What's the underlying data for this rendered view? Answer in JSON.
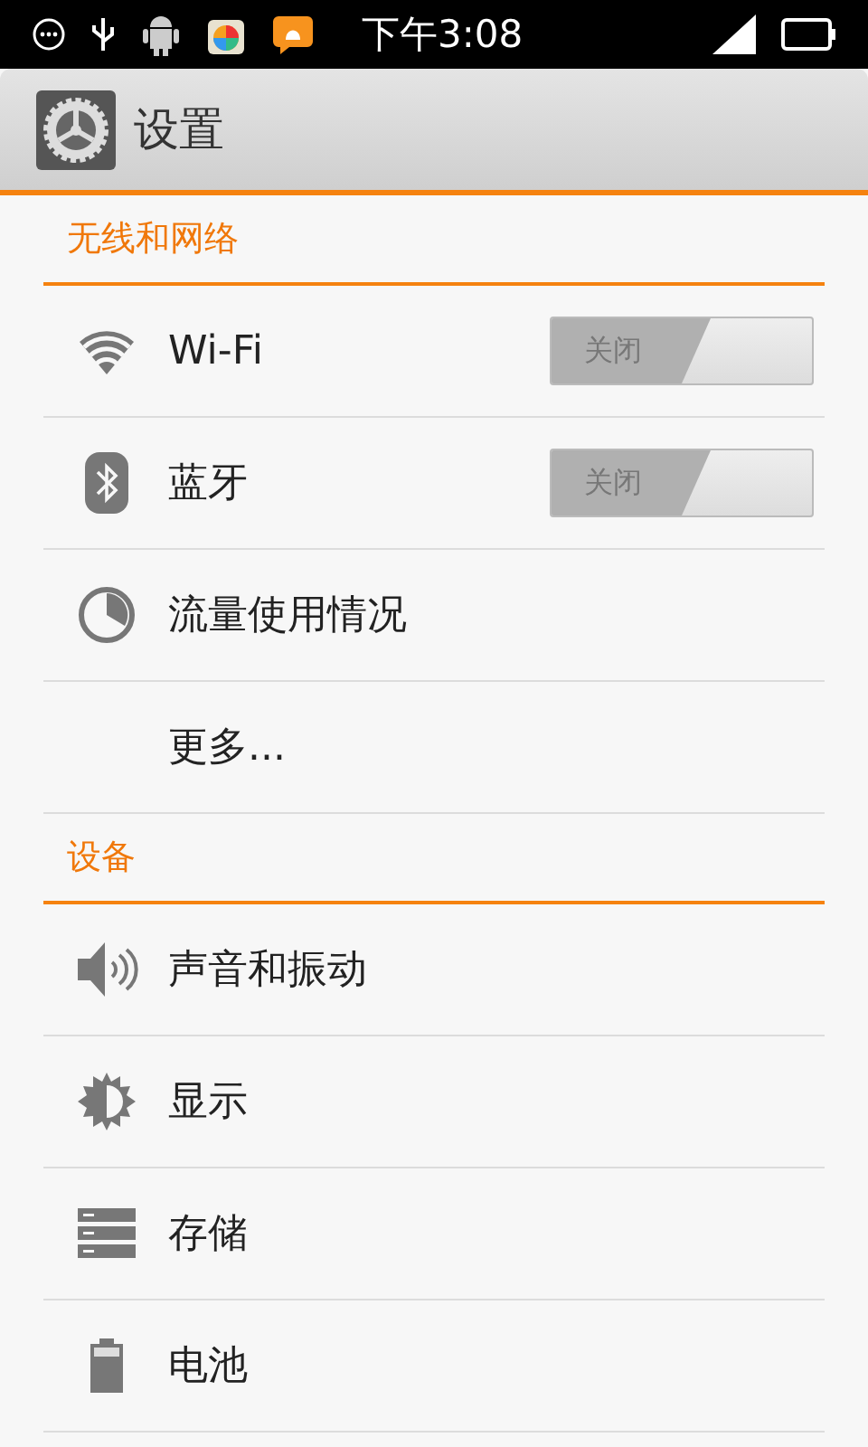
{
  "status_bar": {
    "time": "下午3:08"
  },
  "title_bar": {
    "title": "设置"
  },
  "sections": [
    {
      "title": "无线和网络",
      "items": [
        {
          "label": "Wi-Fi",
          "kind": "toggle",
          "on": false,
          "toggle_text": "关闭"
        },
        {
          "label": "蓝牙",
          "kind": "toggle",
          "on": false,
          "toggle_text": "关闭"
        },
        {
          "label": "流量使用情况",
          "kind": "plain"
        },
        {
          "label": "更多...",
          "kind": "plain"
        }
      ]
    },
    {
      "title": "设备",
      "items": [
        {
          "label": "声音和振动",
          "kind": "plain"
        },
        {
          "label": "显示",
          "kind": "plain"
        },
        {
          "label": "存储",
          "kind": "plain"
        },
        {
          "label": "电池",
          "kind": "plain"
        }
      ]
    }
  ]
}
